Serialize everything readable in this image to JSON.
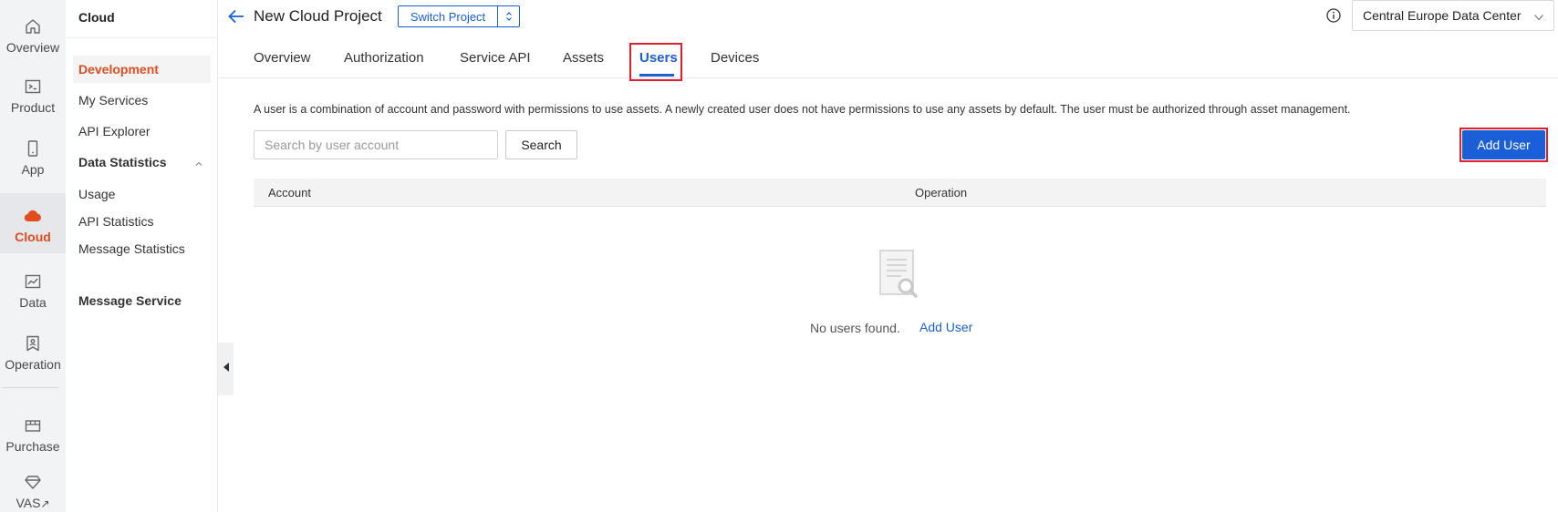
{
  "rail": {
    "items": [
      {
        "label": "Overview",
        "icon": "home-icon"
      },
      {
        "label": "Product",
        "icon": "terminal-icon"
      },
      {
        "label": "App",
        "icon": "phone-icon"
      },
      {
        "label": "Cloud",
        "icon": "cloud-icon"
      },
      {
        "label": "Data",
        "icon": "chart-icon"
      },
      {
        "label": "Operation",
        "icon": "operation-icon"
      },
      {
        "label": "Purchase",
        "icon": "box-icon"
      },
      {
        "label": "VAS",
        "icon": "diamond-icon",
        "external_mark": "↗"
      }
    ],
    "active": "Cloud",
    "accent_color": "#e24d20"
  },
  "sidebar": {
    "title": "Cloud",
    "items": [
      {
        "label": "Development"
      },
      {
        "label": "My Services"
      },
      {
        "label": "API Explorer"
      },
      {
        "label": "Data Statistics"
      },
      {
        "label": "Usage"
      },
      {
        "label": "API Statistics"
      },
      {
        "label": "Message Statistics"
      },
      {
        "label": "Message Service"
      }
    ],
    "active": "Development"
  },
  "header": {
    "project_title": "New Cloud Project",
    "switch_project_label": "Switch Project",
    "data_center": "Central Europe Data Center"
  },
  "tabs": [
    {
      "label": "Overview"
    },
    {
      "label": "Authorization"
    },
    {
      "label": "Service API"
    },
    {
      "label": "Assets"
    },
    {
      "label": "Users"
    },
    {
      "label": "Devices"
    }
  ],
  "active_tab": "Users",
  "content": {
    "description": "A user is a combination of account and password with permissions to use assets. A newly created user does not have permissions to use any assets by default. The user must be authorized through asset management.",
    "search_placeholder": "Search by user account",
    "search_value": "",
    "search_button": "Search",
    "add_user_button": "Add User",
    "table_headers": [
      "Account",
      "Operation"
    ],
    "empty_text": "No users found.",
    "empty_link": "Add User"
  },
  "colors": {
    "primary": "#1a5fd8",
    "highlight_box": "#e0202e"
  }
}
